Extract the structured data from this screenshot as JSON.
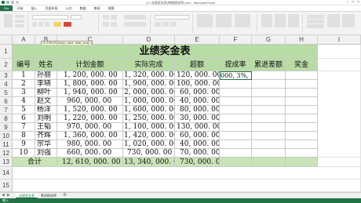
{
  "window": {
    "title": "4.2 业绩奖金表(带期提成率).xlsx - Microsoft Excel"
  },
  "ribbon_tabs": [
    "File",
    "开始",
    "插入",
    "页面布局",
    "公式",
    "数据",
    "审阅",
    "视图"
  ],
  "formula_bar": {
    "name_box": "F3",
    "fx": "fx",
    "formula": "=VLOOKUP(E3,$J$4:$K$9,2)",
    "tooltip": "VLOOKUP(lookup_value, table_array, col_index_num, [range_lookup])"
  },
  "columns": [
    "A",
    "B",
    "C",
    "D",
    "E",
    "F",
    "G",
    "H",
    "I"
  ],
  "rows": [
    "1",
    "2",
    "3",
    "4",
    "5",
    "6",
    "7",
    "8",
    "9",
    "10",
    "11",
    "12",
    "13",
    "14",
    "15"
  ],
  "table": {
    "title": "业绩奖金表",
    "headers": [
      "编号",
      "姓名",
      "计划金额",
      "实际完成",
      "超额",
      "提成率",
      "累进差额",
      "奖金"
    ],
    "data": [
      {
        "id": "1",
        "name": "孙丽",
        "plan": "1, 200, 000. 00",
        "actual": "1, 320, 000. 00",
        "over": "120, 000. 00",
        "rate": "000, 3%, )"
      },
      {
        "id": "2",
        "name": "李晓",
        "plan": "1, 800, 000. 00",
        "actual": "1, 900, 000. 00",
        "over": "100, 000. 00",
        "rate": ""
      },
      {
        "id": "3",
        "name": "柳叶",
        "plan": "1, 940, 000. 00",
        "actual": "2, 000, 000. 00",
        "over": "60, 000. 00",
        "rate": ""
      },
      {
        "id": "4",
        "name": "赵文",
        "plan": "960, 000. 00",
        "actual": "1, 000, 000. 00",
        "over": "40, 000. 00",
        "rate": ""
      },
      {
        "id": "5",
        "name": "杨洋",
        "plan": "1, 520, 000. 00",
        "actual": "1, 600, 000. 00",
        "over": "80, 000. 00",
        "rate": ""
      },
      {
        "id": "6",
        "name": "刘明",
        "plan": "1, 220, 000. 00",
        "actual": "1, 250, 000. 00",
        "over": "30, 000. 00",
        "rate": ""
      },
      {
        "id": "7",
        "name": "王韬",
        "plan": "970, 000. 00",
        "actual": "1, 100, 000. 00",
        "over": "130, 000. 00",
        "rate": ""
      },
      {
        "id": "8",
        "name": "齐辉",
        "plan": "1, 360, 000. 00",
        "actual": "1, 420, 000. 00",
        "over": "60, 000. 00",
        "rate": ""
      },
      {
        "id": "9",
        "name": "宗华",
        "plan": "980, 000. 00",
        "actual": "1, 020, 000. 00",
        "over": "40, 000. 00",
        "rate": ""
      },
      {
        "id": "10",
        "name": "刘强",
        "plan": "660, 000. 00",
        "actual": "730, 000. 00",
        "over": "70, 000. 00",
        "rate": ""
      }
    ],
    "total": {
      "label": "合计",
      "plan": "12, 610, 000. 00",
      "actual": "13, 340, 000. 00",
      "over": "730, 000. 00"
    }
  },
  "sheet_tabs": [
    "业绩奖金表",
    "累进提成率"
  ],
  "status": "输入",
  "colors": {
    "header_green": "#b9dba6",
    "excel_green": "#217346"
  }
}
